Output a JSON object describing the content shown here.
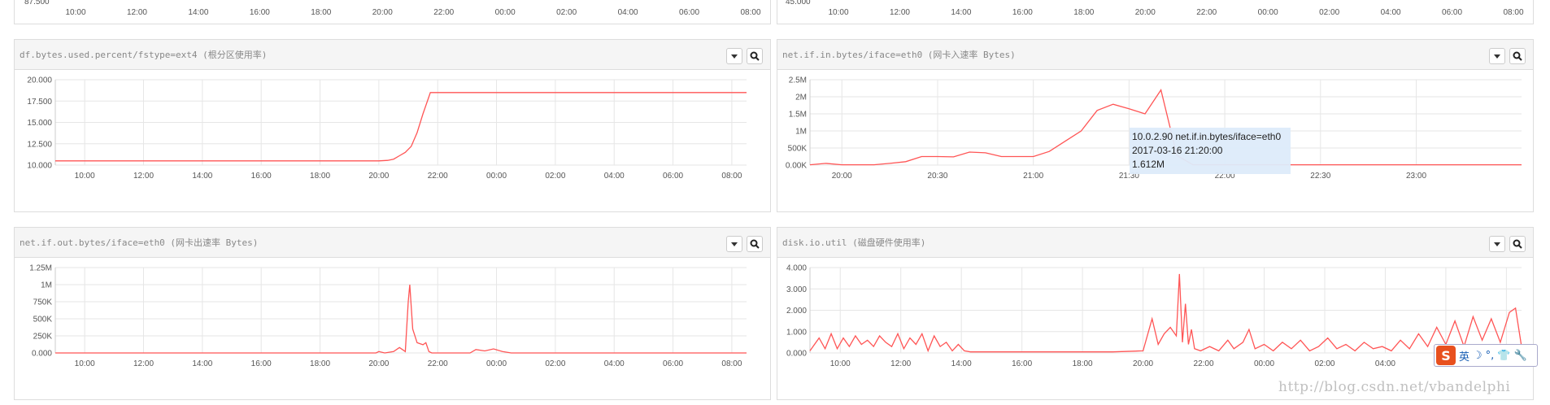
{
  "colors": {
    "line": "#ff5555",
    "grid": "#e6e6e6",
    "axis": "#555555",
    "tooltip_bg": "#ddebfa"
  },
  "top_partial": {
    "left": {
      "y_label": "87.500",
      "x_ticks": [
        "10:00",
        "12:00",
        "14:00",
        "16:00",
        "18:00",
        "20:00",
        "22:00",
        "00:00",
        "02:00",
        "04:00",
        "06:00",
        "08:00"
      ]
    },
    "right": {
      "y_label": "45.000",
      "x_ticks": [
        "10:00",
        "12:00",
        "14:00",
        "16:00",
        "18:00",
        "20:00",
        "22:00",
        "00:00",
        "02:00",
        "04:00",
        "06:00",
        "08:00"
      ]
    }
  },
  "panels": [
    {
      "title": "df.bytes.used.percent/fstype=ext4 (根分区使用率)",
      "dropdown_icon": "caret-down-icon",
      "zoom_icon": "zoom-icon"
    },
    {
      "title": "net.if.in.bytes/iface=eth0 (网卡入速率 Bytes)",
      "dropdown_icon": "caret-down-icon",
      "zoom_icon": "zoom-icon"
    },
    {
      "title": "net.if.out.bytes/iface=eth0 (网卡出速率 Bytes)",
      "dropdown_icon": "caret-down-icon",
      "zoom_icon": "zoom-icon"
    },
    {
      "title": "disk.io.util (磁盘硬件使用率)",
      "dropdown_icon": "caret-down-icon",
      "zoom_icon": "zoom-icon"
    }
  ],
  "tooltip": {
    "line1": "10.0.2.90 net.if.in.bytes/iface=eth0",
    "line2": "2017-03-16 21:20:00",
    "line3": "1.612M"
  },
  "ime": {
    "lang": "英",
    "items": [
      "☽",
      "°,",
      "👕",
      "🔧"
    ]
  },
  "watermark": "http://blog.csdn.net/vbandelphi",
  "chart_data": [
    {
      "type": "line",
      "title": "df.bytes.used.percent/fstype=ext4 (根分区使用率)",
      "x_tick_labels": [
        "10:00",
        "12:00",
        "14:00",
        "16:00",
        "18:00",
        "20:00",
        "22:00",
        "00:00",
        "02:00",
        "04:00",
        "06:00",
        "08:00"
      ],
      "y_tick_labels": [
        "10.000",
        "12.500",
        "15.000",
        "17.500",
        "20.000"
      ],
      "ylim": [
        10,
        20
      ],
      "xlim_hours": [
        9.0,
        32.5
      ],
      "grid": true,
      "series": [
        {
          "x_hours": [
            9.0,
            12,
            15,
            18,
            20.0,
            20.3,
            20.5,
            20.7,
            20.9,
            21.1,
            21.3,
            21.5,
            21.7,
            21.75,
            22,
            25,
            28,
            32.5
          ],
          "values": [
            10.5,
            10.5,
            10.5,
            10.5,
            10.5,
            10.55,
            10.7,
            11.1,
            11.5,
            12.2,
            13.8,
            16.0,
            18.0,
            18.5,
            18.5,
            18.5,
            18.5,
            18.5
          ]
        }
      ]
    },
    {
      "type": "line",
      "title": "net.if.in.bytes/iface=eth0 (网卡入速率 Bytes)",
      "x_tick_labels": [
        "20:00",
        "20:30",
        "21:00",
        "21:30",
        "22:00",
        "22:30",
        "23:00"
      ],
      "y_tick_labels": [
        "0.00K",
        "500K",
        "1M",
        "1.5M",
        "2M",
        "2.5M"
      ],
      "ylim": [
        0,
        2500000
      ],
      "xlim_minutes": [
        1190,
        1413
      ],
      "grid": true,
      "series": [
        {
          "x_minutes": [
            1190,
            1195,
            1200,
            1205,
            1210,
            1215,
            1220,
            1225,
            1230,
            1235,
            1240,
            1245,
            1250,
            1255,
            1260,
            1265,
            1270,
            1275,
            1280,
            1285,
            1290,
            1295,
            1300,
            1305,
            1310,
            1315,
            1320,
            1340,
            1360,
            1380,
            1413
          ],
          "values": [
            10000,
            50000,
            10000,
            10000,
            10000,
            50000,
            100000,
            250000,
            250000,
            240000,
            380000,
            360000,
            250000,
            250000,
            250000,
            400000,
            700000,
            1000000,
            1600000,
            1780000,
            1650000,
            1500000,
            2200000,
            280000,
            10000,
            10000,
            10000,
            10000,
            10000,
            10000,
            10000
          ]
        }
      ]
    },
    {
      "type": "line",
      "title": "net.if.out.bytes/iface=eth0 (网卡出速率 Bytes)",
      "x_tick_labels": [
        "10:00",
        "12:00",
        "14:00",
        "16:00",
        "18:00",
        "20:00",
        "22:00",
        "00:00",
        "02:00",
        "04:00",
        "06:00",
        "08:00"
      ],
      "y_tick_labels": [
        "0.000",
        "250K",
        "500K",
        "750K",
        "1M",
        "1.25M"
      ],
      "ylim": [
        0,
        1250000
      ],
      "xlim_hours": [
        9.0,
        32.5
      ],
      "grid": true,
      "series": [
        {
          "x_hours": [
            9.0,
            16,
            19.9,
            20.0,
            20.2,
            20.5,
            20.7,
            20.9,
            21.0,
            21.05,
            21.15,
            21.3,
            21.5,
            21.6,
            21.7,
            21.8,
            22.5,
            23.1,
            23.3,
            23.6,
            23.9,
            24.2,
            24.5,
            26,
            30,
            32.5
          ],
          "values": [
            0,
            0,
            0,
            20000,
            0,
            20000,
            80000,
            20000,
            750000,
            1000000,
            350000,
            150000,
            120000,
            150000,
            20000,
            0,
            0,
            0,
            50000,
            30000,
            60000,
            20000,
            0,
            0,
            0,
            0
          ]
        }
      ]
    },
    {
      "type": "line",
      "title": "disk.io.util (磁盘硬件使用率)",
      "x_tick_labels": [
        "10:00",
        "12:00",
        "14:00",
        "16:00",
        "18:00",
        "20:00",
        "22:00",
        "00:00",
        "02:00",
        "04:00",
        "06:00",
        "08:00"
      ],
      "y_tick_labels": [
        "0.000",
        "1.000",
        "2.000",
        "3.000",
        "4.000"
      ],
      "ylim": [
        0,
        4
      ],
      "xlim_hours": [
        9.0,
        32.5
      ],
      "grid": true,
      "series": [
        {
          "x_hours": [
            9.0,
            9.3,
            9.5,
            9.7,
            9.9,
            10.1,
            10.3,
            10.5,
            10.7,
            10.9,
            11.1,
            11.3,
            11.5,
            11.7,
            11.9,
            12.1,
            12.3,
            12.5,
            12.7,
            12.9,
            13.1,
            13.3,
            13.5,
            13.7,
            13.9,
            14.1,
            14.3,
            15,
            16,
            17,
            18,
            19,
            20.0,
            20.3,
            20.5,
            20.7,
            20.9,
            21.1,
            21.2,
            21.3,
            21.4,
            21.5,
            21.6,
            21.7,
            21.9,
            22.2,
            22.5,
            22.8,
            23.0,
            23.3,
            23.5,
            23.7,
            24.0,
            24.3,
            24.6,
            24.9,
            25.2,
            25.5,
            25.8,
            26.1,
            26.4,
            26.7,
            27.0,
            27.3,
            27.6,
            27.9,
            28.2,
            28.5,
            28.8,
            29.1,
            29.4,
            29.7,
            30.0,
            30.3,
            30.6,
            30.9,
            31.2,
            31.5,
            31.8,
            32.1,
            32.3,
            32.5
          ],
          "values": [
            0.1,
            0.7,
            0.2,
            0.9,
            0.2,
            0.7,
            0.3,
            0.8,
            0.4,
            0.6,
            0.3,
            0.8,
            0.5,
            0.3,
            0.9,
            0.2,
            0.7,
            0.4,
            0.9,
            0.1,
            0.8,
            0.3,
            0.5,
            0.1,
            0.4,
            0.1,
            0.05,
            0.05,
            0.05,
            0.05,
            0.05,
            0.05,
            0.1,
            1.6,
            0.4,
            0.9,
            1.2,
            0.8,
            3.7,
            0.5,
            2.3,
            0.4,
            1.1,
            0.2,
            0.1,
            0.3,
            0.1,
            0.6,
            0.2,
            0.5,
            1.1,
            0.2,
            0.4,
            0.1,
            0.5,
            0.2,
            0.6,
            0.1,
            0.3,
            0.7,
            0.2,
            0.4,
            0.1,
            0.5,
            0.2,
            0.3,
            0.1,
            0.6,
            0.2,
            0.9,
            0.3,
            1.2,
            0.4,
            1.5,
            0.3,
            1.7,
            0.6,
            1.6,
            0.5,
            1.9,
            2.1,
            0.3
          ]
        }
      ]
    }
  ]
}
